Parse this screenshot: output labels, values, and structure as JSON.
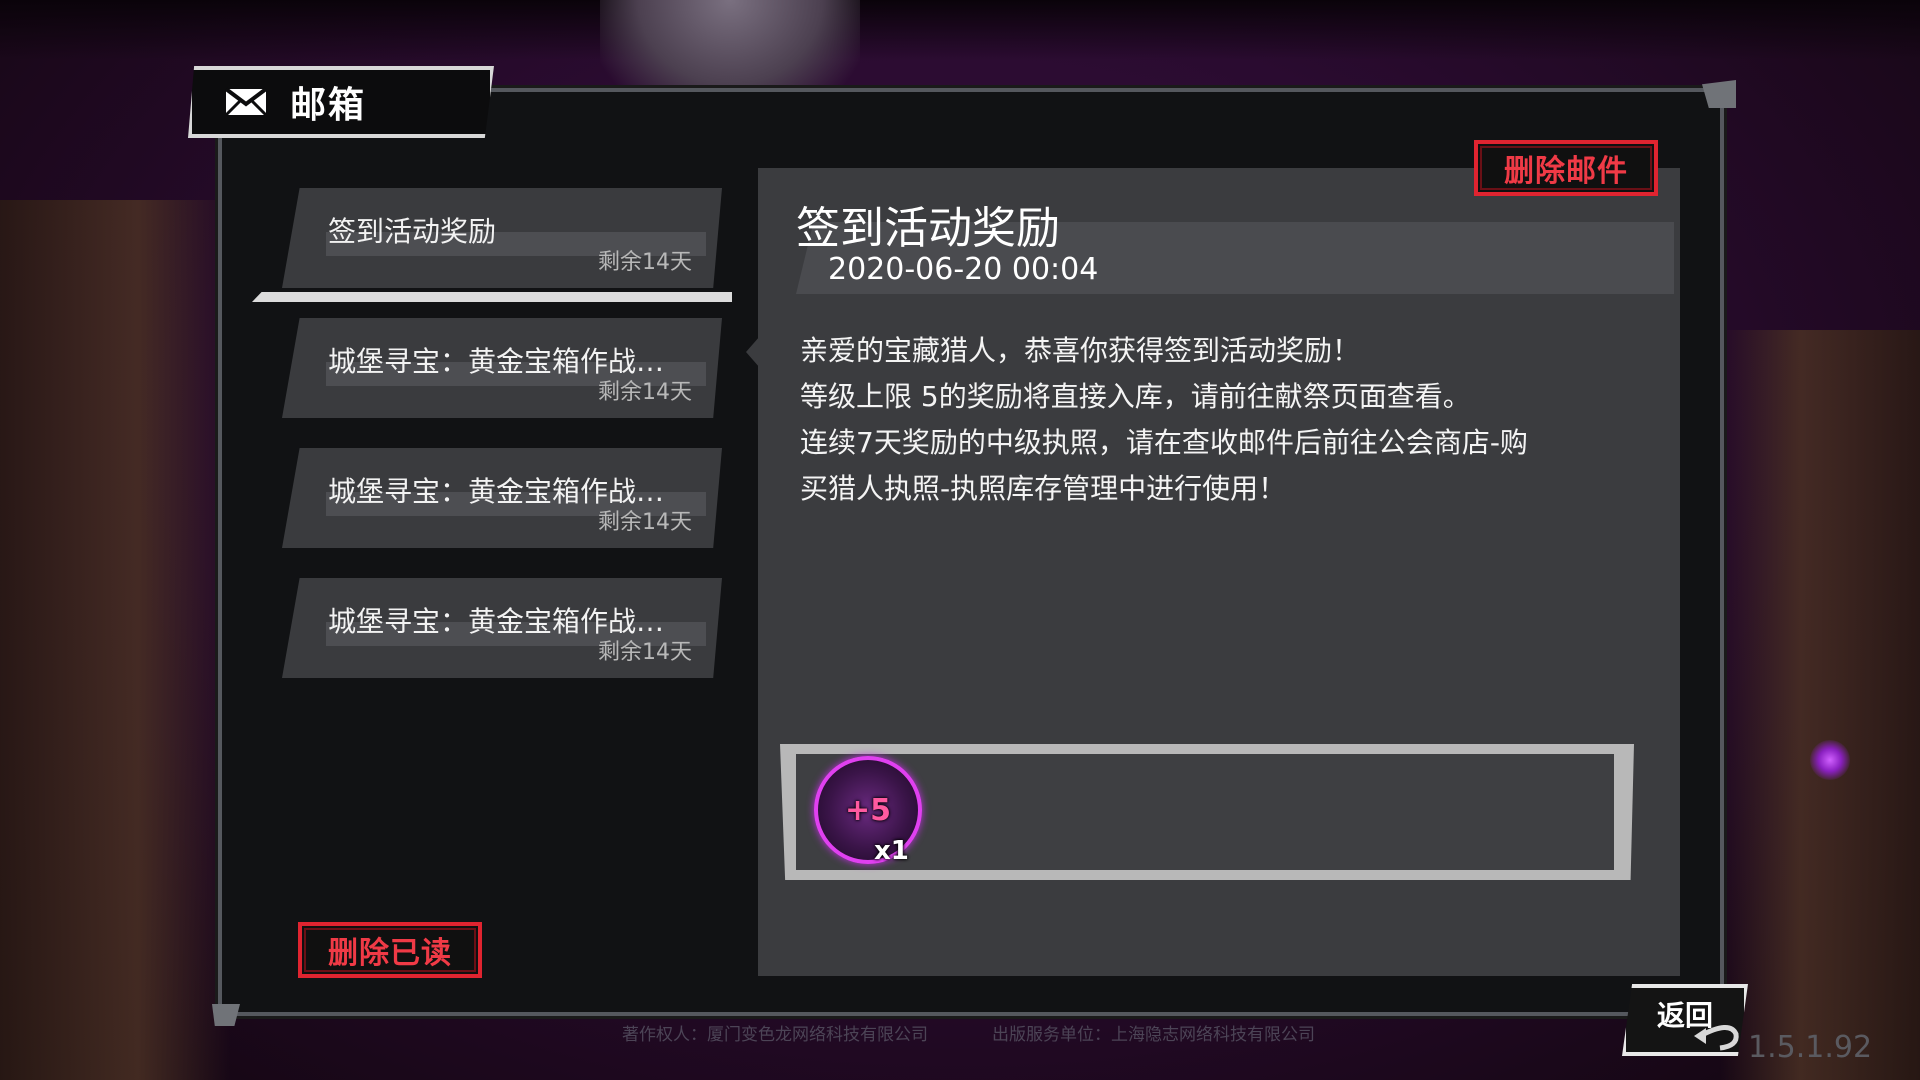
{
  "window": {
    "title": "邮箱"
  },
  "mail_list": {
    "items": [
      {
        "title": "签到活动奖励",
        "days_left": "剩余14天",
        "selected": true
      },
      {
        "title": "城堡寻宝：黄金宝箱作战…",
        "days_left": "剩余14天",
        "selected": false
      },
      {
        "title": "城堡寻宝：黄金宝箱作战…",
        "days_left": "剩余14天",
        "selected": false
      },
      {
        "title": "城堡寻宝：黄金宝箱作战…",
        "days_left": "剩余14天",
        "selected": false
      }
    ]
  },
  "detail": {
    "title": "签到活动奖励",
    "date": "2020-06-20 00:04",
    "body": [
      "亲爱的宝藏猎人，恭喜你获得签到活动奖励！",
      "等级上限 5的奖励将直接入库，请前往献祭页面查看。",
      "连续7天奖励的中级执照，请在查收邮件后前往公会商店-购",
      "买猎人执照-执照库存管理中进行使用！"
    ],
    "attachment": {
      "icon": "level-cap-plus5-icon",
      "icon_text": "+5",
      "count": "x1"
    }
  },
  "buttons": {
    "delete_mail": "删除邮件",
    "delete_read": "删除已读",
    "back": "返回"
  },
  "footer": {
    "copyright_owner": "著作权人：厦门变色龙网络科技有限公司",
    "publisher": "出版服务单位：上海隐志网络科技有限公司",
    "version": "1.5.1.92"
  },
  "colors": {
    "accent_red": "#e02430",
    "panel_bg": "#111214",
    "card_bg": "#3a3b3e",
    "item_glow": "#e040f0"
  }
}
